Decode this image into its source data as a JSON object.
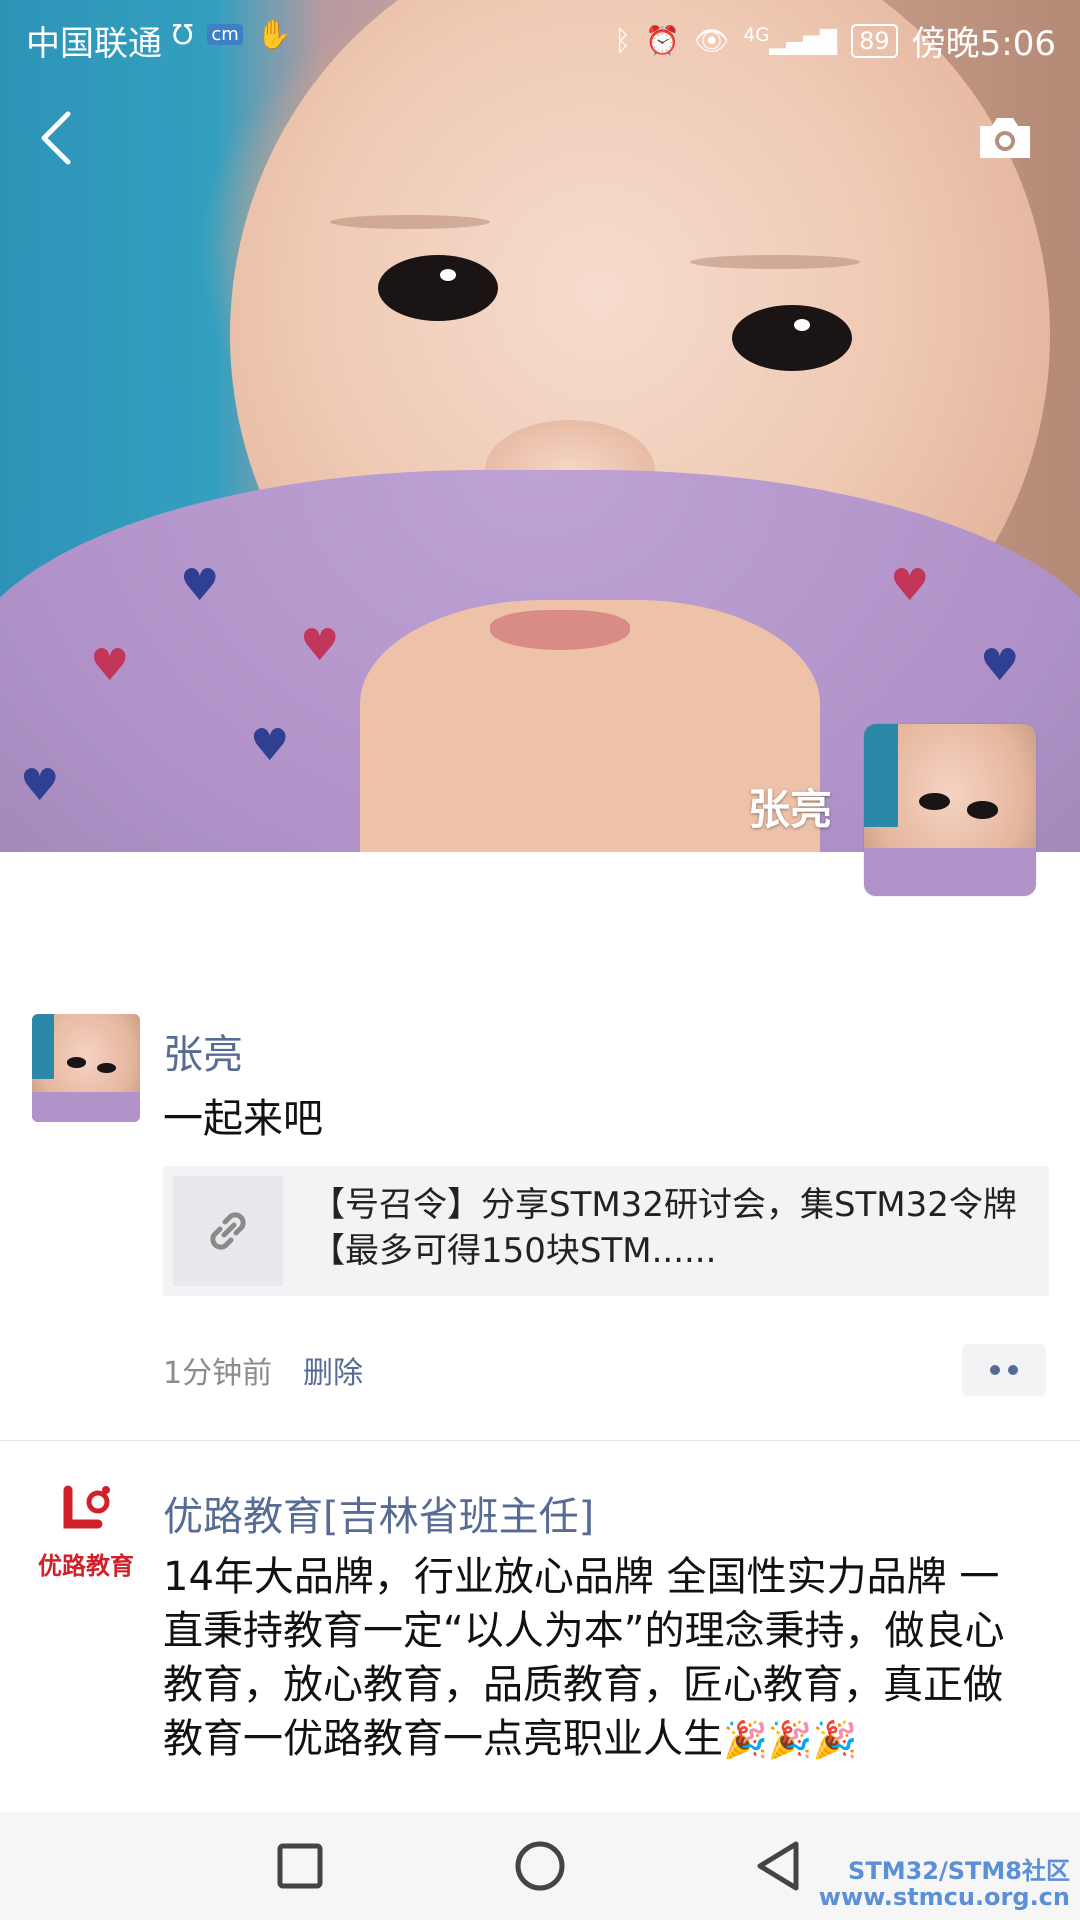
{
  "status_bar": {
    "carrier": "中国联通",
    "network": "4G",
    "battery": "89",
    "time": "傍晚5:06"
  },
  "cover": {
    "name": "张亮"
  },
  "post": {
    "username": "张亮",
    "content": "一起来吧",
    "link_title": "【号召令】分享STM32研讨会，集STM32令牌 【最多可得150块STM......",
    "time": "1分钟前",
    "delete_label": "删除"
  },
  "ad_post": {
    "logo_text": "优路教育",
    "username": "优路教育[吉林省班主任]",
    "content": "14年大品牌，行业放心品牌 全国性实力品牌 一直秉持教育一定“以人为本”的理念秉持，做良心教育，放心教育，品质教育，匠心教育，真正做教育一优路教育一点亮职业人生",
    "emoji": "🎉🎉🎉"
  },
  "watermark": {
    "line1": "STM32/STM8社区",
    "line2": "www.stmcu.org.cn"
  },
  "colors": {
    "link_blue": "#576b95",
    "brand_red": "#d0202a"
  }
}
